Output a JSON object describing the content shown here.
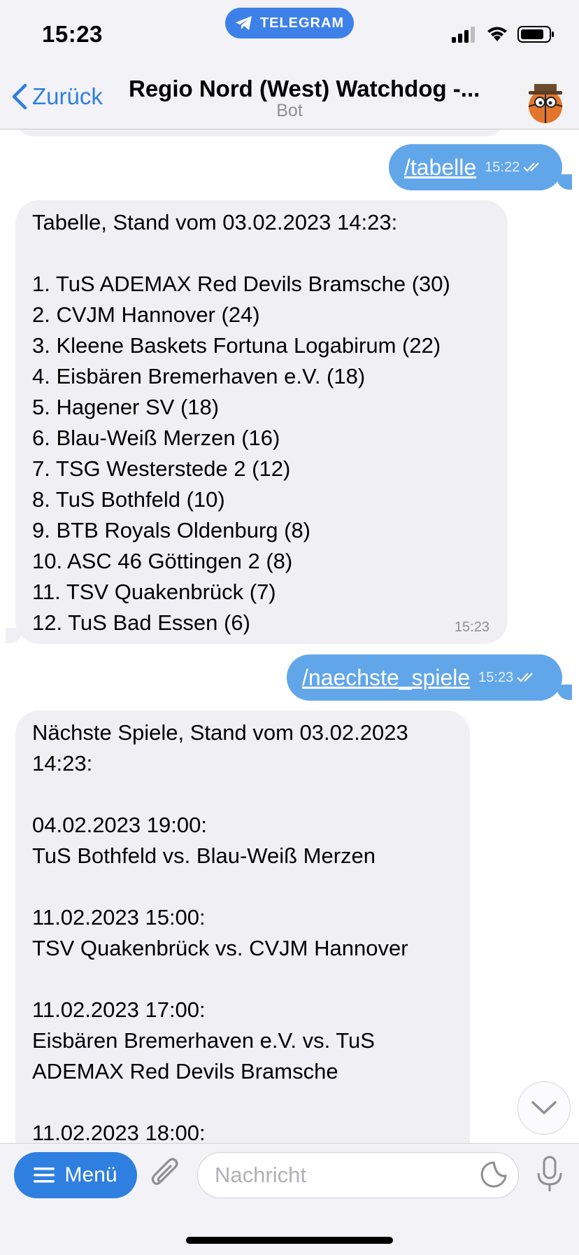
{
  "status_bar": {
    "time": "15:23",
    "banner": "TELEGRAM"
  },
  "header": {
    "back_label": "Zurück",
    "title": "Regio Nord (West) Watchdog -...",
    "subtitle": "Bot"
  },
  "messages": {
    "out1": {
      "text": "/tabelle",
      "time": "15:22"
    },
    "in1": {
      "lines": [
        "Tabelle, Stand vom 03.02.2023  14:23:",
        "",
        "1.  TuS ADEMAX Red Devils Bramsche  (30)",
        "2.  CVJM Hannover  (24)",
        "3.  Kleene Baskets Fortuna Logabirum  (22)",
        "4.  Eisbären Bremerhaven e.V.  (18)",
        "5.  Hagener SV  (18)",
        "6.  Blau-Weiß Merzen  (16)",
        "7.  TSG Westerstede 2  (12)",
        "8.  TuS Bothfeld  (10)",
        "9.  BTB Royals Oldenburg  (8)",
        "10.  ASC 46 Göttingen 2  (8)",
        "11.  TSV Quakenbrück  (7)",
        "12.  TuS Bad Essen  (6)"
      ],
      "time": "15:23"
    },
    "out2": {
      "text": "/naechste_spiele",
      "time": "15:23"
    },
    "in2": {
      "lines": [
        "Nächste Spiele, Stand vom 03.02.2023",
        "14:23:",
        "",
        "04.02.2023  19:00:",
        "TuS Bothfeld  vs. Blau-Weiß Merzen",
        "",
        "11.02.2023  15:00:",
        "TSV Quakenbrück  vs. CVJM Hannover",
        "",
        "11.02.2023  17:00:",
        "Eisbären Bremerhaven e.V.  vs. TuS",
        "ADEMAX Red Devils Bramsche",
        "",
        "11.02.2023  18:00:"
      ]
    }
  },
  "input_bar": {
    "menu_label": "Menü",
    "placeholder": "Nachricht"
  },
  "colors": {
    "accent": "#2f7fe0",
    "outgoing_bubble": "#62a6ea",
    "incoming_bubble": "#f0f0f4"
  }
}
